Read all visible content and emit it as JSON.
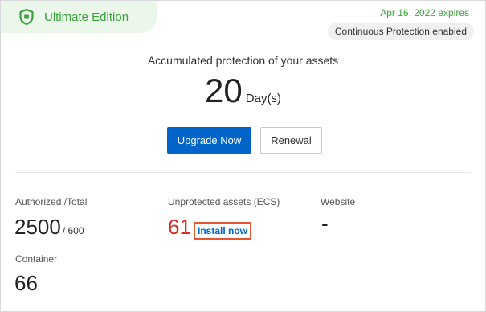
{
  "edition": {
    "name": "Ultimate Edition",
    "icon": "shield-icon",
    "color": "#3ba13b",
    "banner_bg": "#eaf7ea"
  },
  "status": {
    "expires": "Apr 16, 2022 expires",
    "badge": "Continuous Protection enabled"
  },
  "protection": {
    "headline": "Accumulated protection of your assets",
    "days": "20",
    "unit": "Day(s)"
  },
  "actions": {
    "upgrade_label": "Upgrade Now",
    "renewal_label": "Renewal",
    "primary_color": "#0064c8"
  },
  "stats": {
    "authorized": {
      "label": "Authorized /Total",
      "value": "2500",
      "total": "/ 600"
    },
    "unprotected": {
      "label": "Unprotected assets (ECS)",
      "value": "61",
      "link_label": "Install now",
      "value_color": "#d93026"
    },
    "website": {
      "label": "Website",
      "value": "-"
    },
    "container": {
      "label": "Container",
      "value": "66"
    }
  }
}
